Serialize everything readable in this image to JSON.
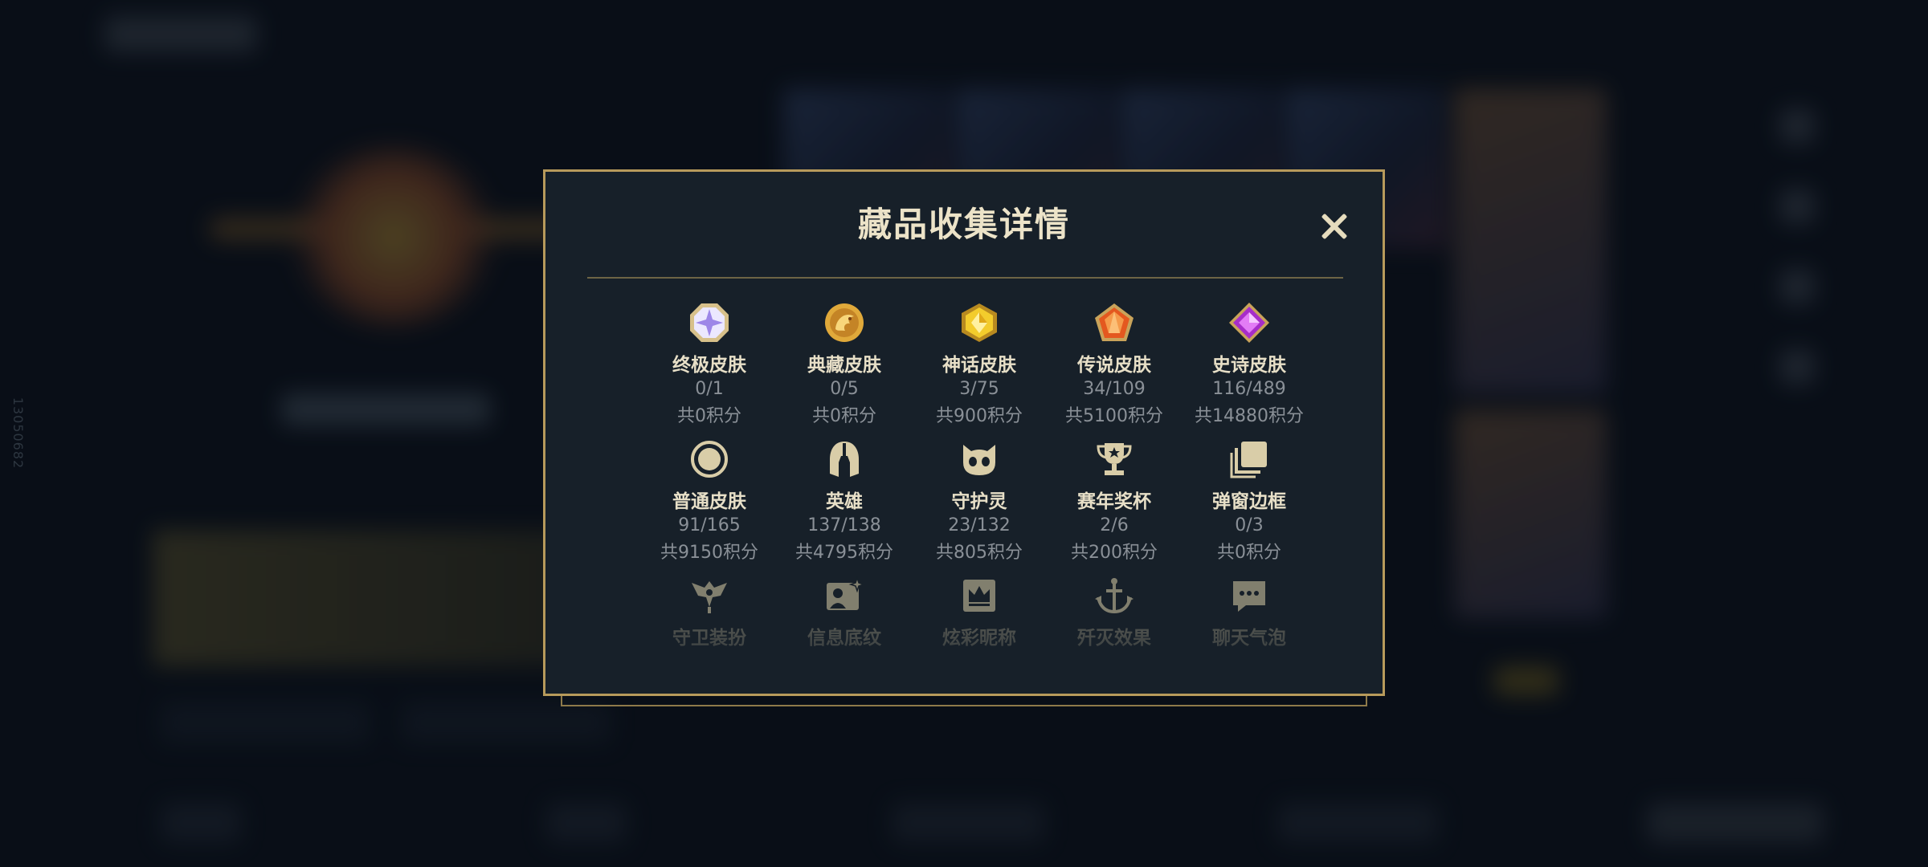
{
  "dialog": {
    "title": "藏品收集详情",
    "close_icon": "close-icon"
  },
  "side_code": "13050682",
  "categories": [
    {
      "name": "终极皮肤",
      "count": "0/1",
      "points": "共0积分",
      "icon": "octagon-gem-icon",
      "color": "#c7b6ee"
    },
    {
      "name": "典藏皮肤",
      "count": "0/5",
      "points": "共0积分",
      "icon": "dragon-coin-icon",
      "color": "#e0a93a"
    },
    {
      "name": "神话皮肤",
      "count": "3/75",
      "points": "共900积分",
      "icon": "hexagon-gem-icon",
      "color": "#f0c52c"
    },
    {
      "name": "传说皮肤",
      "count": "34/109",
      "points": "共5100积分",
      "icon": "pentagon-gem-icon",
      "color": "#e2622a"
    },
    {
      "name": "史诗皮肤",
      "count": "116/489",
      "points": "共14880积分",
      "icon": "diamond-gem-icon",
      "color": "#b93cd6"
    },
    {
      "name": "普通皮肤",
      "count": "91/165",
      "points": "共9150积分",
      "icon": "circle-ring-icon",
      "color": "#d9cda8"
    },
    {
      "name": "英雄",
      "count": "137/138",
      "points": "共4795积分",
      "icon": "helmet-icon",
      "color": "#d9cda8"
    },
    {
      "name": "守护灵",
      "count": "23/132",
      "points": "共805积分",
      "icon": "guardian-cat-icon",
      "color": "#d9cda8"
    },
    {
      "name": "赛年奖杯",
      "count": "2/6",
      "points": "共200积分",
      "icon": "trophy-icon",
      "color": "#d9cda8"
    },
    {
      "name": "弹窗边框",
      "count": "0/3",
      "points": "共0积分",
      "icon": "stacked-frames-icon",
      "color": "#d9cda8"
    },
    {
      "name": "守卫装扮",
      "icon": "ward-icon",
      "color": "#d9cda8"
    },
    {
      "name": "信息底纹",
      "icon": "card-sparkle-icon",
      "color": "#d9cda8"
    },
    {
      "name": "炫彩昵称",
      "icon": "crown-card-icon",
      "color": "#d9cda8"
    },
    {
      "name": "歼灭效果",
      "icon": "anchor-icon",
      "color": "#d9cda8"
    },
    {
      "name": "聊天气泡",
      "icon": "chat-bubble-icon",
      "color": "#d9cda8"
    }
  ],
  "colors": {
    "panel_bg": "#172029",
    "panel_border": "#b79a5b",
    "title_text": "#ece3c8",
    "muted_text": "#8a9097"
  }
}
